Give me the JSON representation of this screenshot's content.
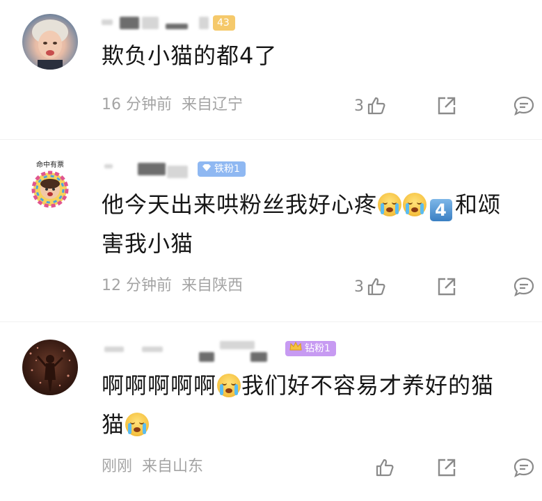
{
  "comments": [
    {
      "text": "欺负小猫的都4了",
      "time": "16 分钟前",
      "location": "来自辽宁",
      "likes": "3",
      "badge": "43",
      "badge_color": "#f5c96b"
    },
    {
      "text_before": "他今天出来哄粉丝我好心疼",
      "keycap": "4",
      "text_after": "和颂",
      "text_line2": "害我小猫",
      "time": "12 分钟前",
      "location": "来自陕西",
      "likes": "3",
      "badge": "铁粉1",
      "badge_color": "#8fb8f2",
      "avatar_caption": "命中有票"
    },
    {
      "text_before": "啊啊啊啊啊",
      "text_after": "我们好不容易才养好的猫",
      "text_line2": "猫",
      "time": "刚刚",
      "location": "来自山东",
      "badge": "钻粉1",
      "badge_color": "#c79af2"
    }
  ],
  "icons": [
    "thumbs-up-icon",
    "share-icon",
    "comment-icon",
    "diamond-icon",
    "crown-icon"
  ]
}
